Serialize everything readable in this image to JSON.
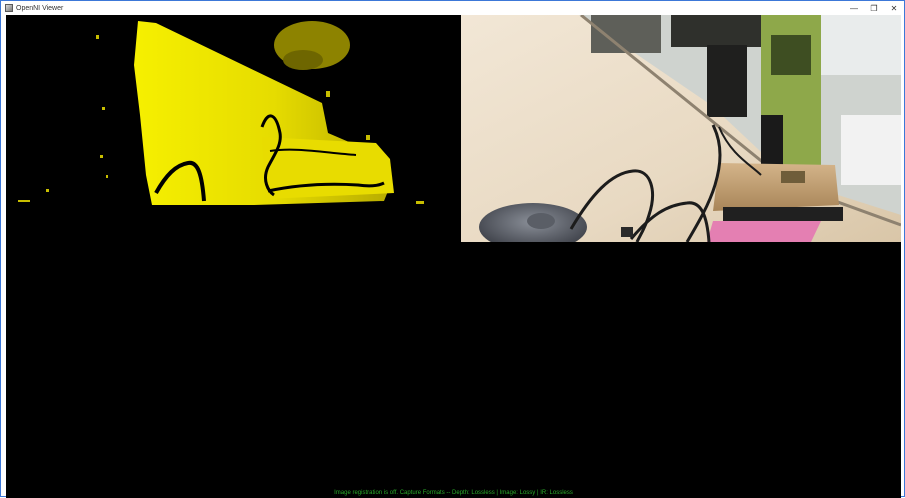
{
  "window": {
    "title": "OpenNI Viewer",
    "app_icon": "openni-viewer-icon",
    "controls": {
      "minimize": "—",
      "restore": "❐",
      "close": "✕"
    }
  },
  "colors": {
    "window_border": "#3c78d8",
    "viewport_background": "#000000",
    "depth_highlight": "#f0e600",
    "status_text": "#2aa82a"
  },
  "status_bar": {
    "text": "Image registration is off. Capture Formats -- Depth: Lossless | Image: Lossy | IR: Lossless"
  },
  "panes": {
    "depth": {
      "kind": "depth-map-visualization"
    },
    "color": {
      "kind": "color-camera-image"
    }
  }
}
